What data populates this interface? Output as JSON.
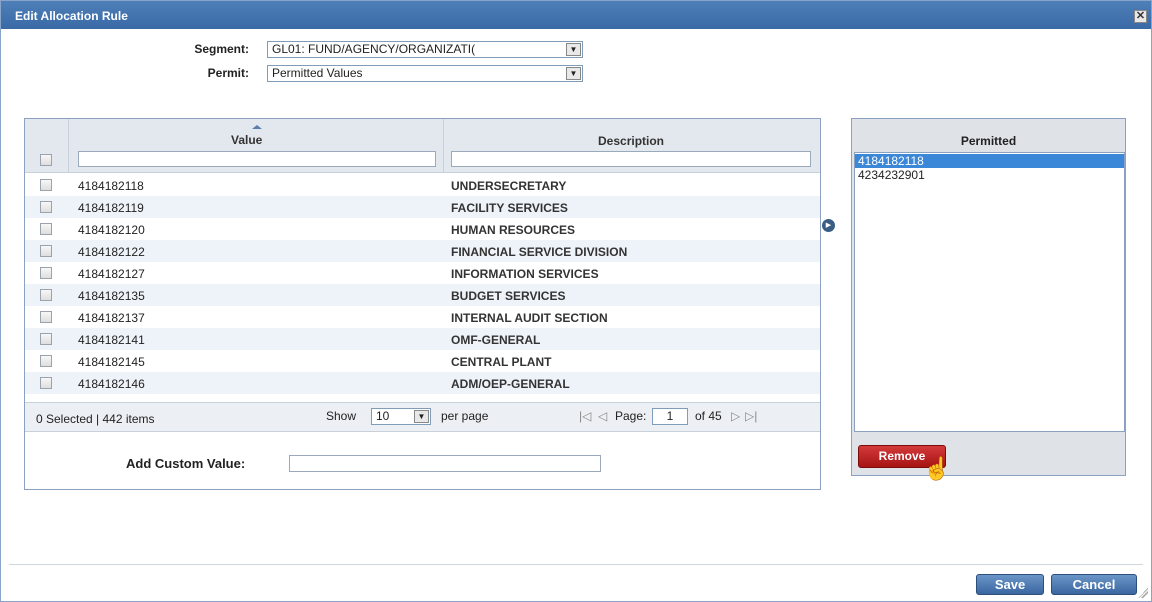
{
  "dialog": {
    "title": "Edit Allocation Rule",
    "close_symbol": "✕"
  },
  "form": {
    "segment_label": "Segment:",
    "segment_value": "GL01: FUND/AGENCY/ORGANIZATI(",
    "permit_label": "Permit:",
    "permit_value": "Permitted Values"
  },
  "grid": {
    "columns": {
      "value": "Value",
      "description": "Description"
    },
    "rows": [
      {
        "value": "4184182118",
        "description": "UNDERSECRETARY"
      },
      {
        "value": "4184182119",
        "description": "FACILITY SERVICES"
      },
      {
        "value": "4184182120",
        "description": "HUMAN RESOURCES"
      },
      {
        "value": "4184182122",
        "description": "FINANCIAL SERVICE DIVISION"
      },
      {
        "value": "4184182127",
        "description": "INFORMATION SERVICES"
      },
      {
        "value": "4184182135",
        "description": "BUDGET SERVICES"
      },
      {
        "value": "4184182137",
        "description": "INTERNAL AUDIT SECTION"
      },
      {
        "value": "4184182141",
        "description": "OMF-GENERAL"
      },
      {
        "value": "4184182145",
        "description": "CENTRAL PLANT"
      },
      {
        "value": "4184182146",
        "description": "ADM/OEP-GENERAL"
      }
    ],
    "footer": {
      "selected_text": "0 Selected | 442 items",
      "show_label": "Show",
      "page_size": "10",
      "per_page_label": "per page",
      "page_label": "Page:",
      "page_number": "1",
      "of_pages": "of 45"
    },
    "add_custom_label": "Add Custom Value:"
  },
  "permitted": {
    "header": "Permitted",
    "items": [
      "4184182118",
      "4234232901"
    ],
    "selected_index": 0,
    "remove_label": "Remove"
  },
  "buttons": {
    "save": "Save",
    "cancel": "Cancel"
  },
  "colors": {
    "title_bar": "#3f70ad",
    "selection": "#3b87d8",
    "remove_button": "#b81e1e",
    "primary_button": "#4a78b4"
  },
  "icons": {
    "close": "close-icon",
    "move": "arrow-right-circle-icon",
    "sort": "sort-ascending-icon",
    "cursor": "hand-pointer-icon"
  }
}
